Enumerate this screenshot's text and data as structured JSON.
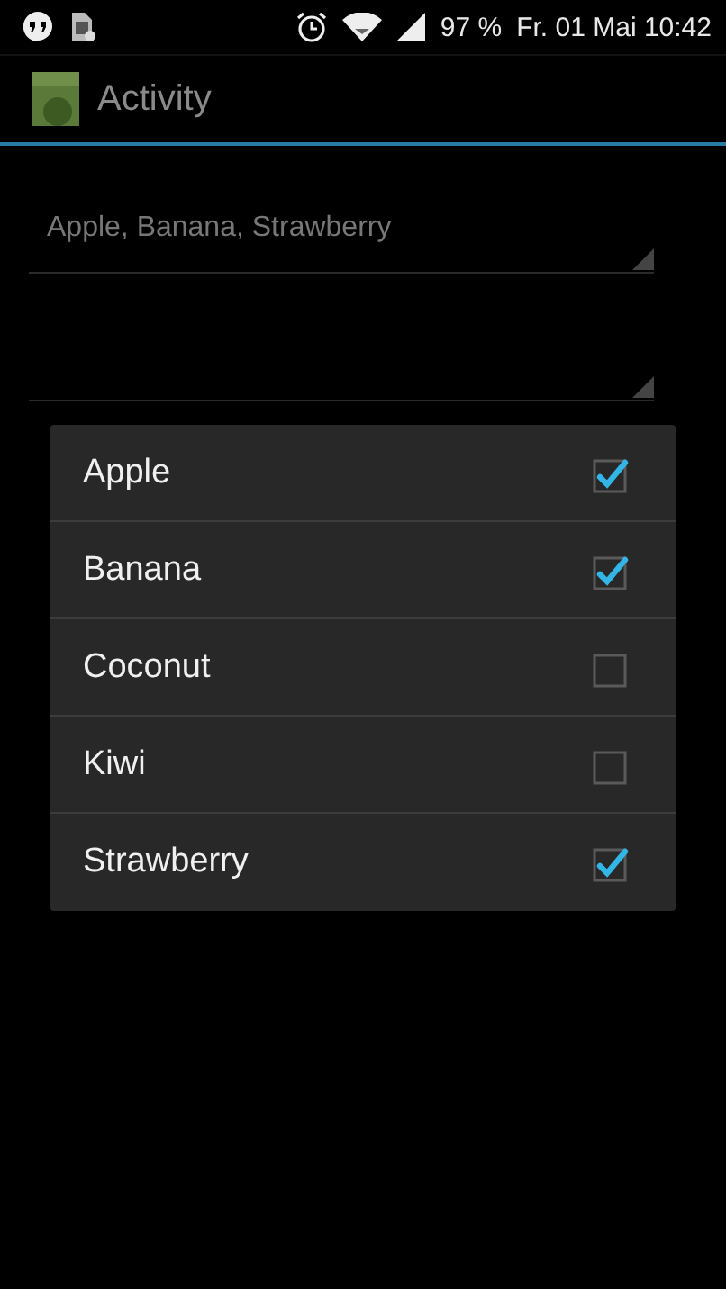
{
  "status_bar": {
    "battery": "97 %",
    "datetime": "Fr. 01 Mai 10:42"
  },
  "action_bar": {
    "title": "Activity"
  },
  "spinners": [
    {
      "kind": "text",
      "value": "Apple, Banana, Strawberry"
    },
    {
      "kind": "blank"
    }
  ],
  "dialog": {
    "items": [
      {
        "label": "Apple",
        "checked": true
      },
      {
        "label": "Banana",
        "checked": true
      },
      {
        "label": "Coconut",
        "checked": false
      },
      {
        "label": "Kiwi",
        "checked": false
      },
      {
        "label": "Strawberry",
        "checked": true
      }
    ]
  }
}
